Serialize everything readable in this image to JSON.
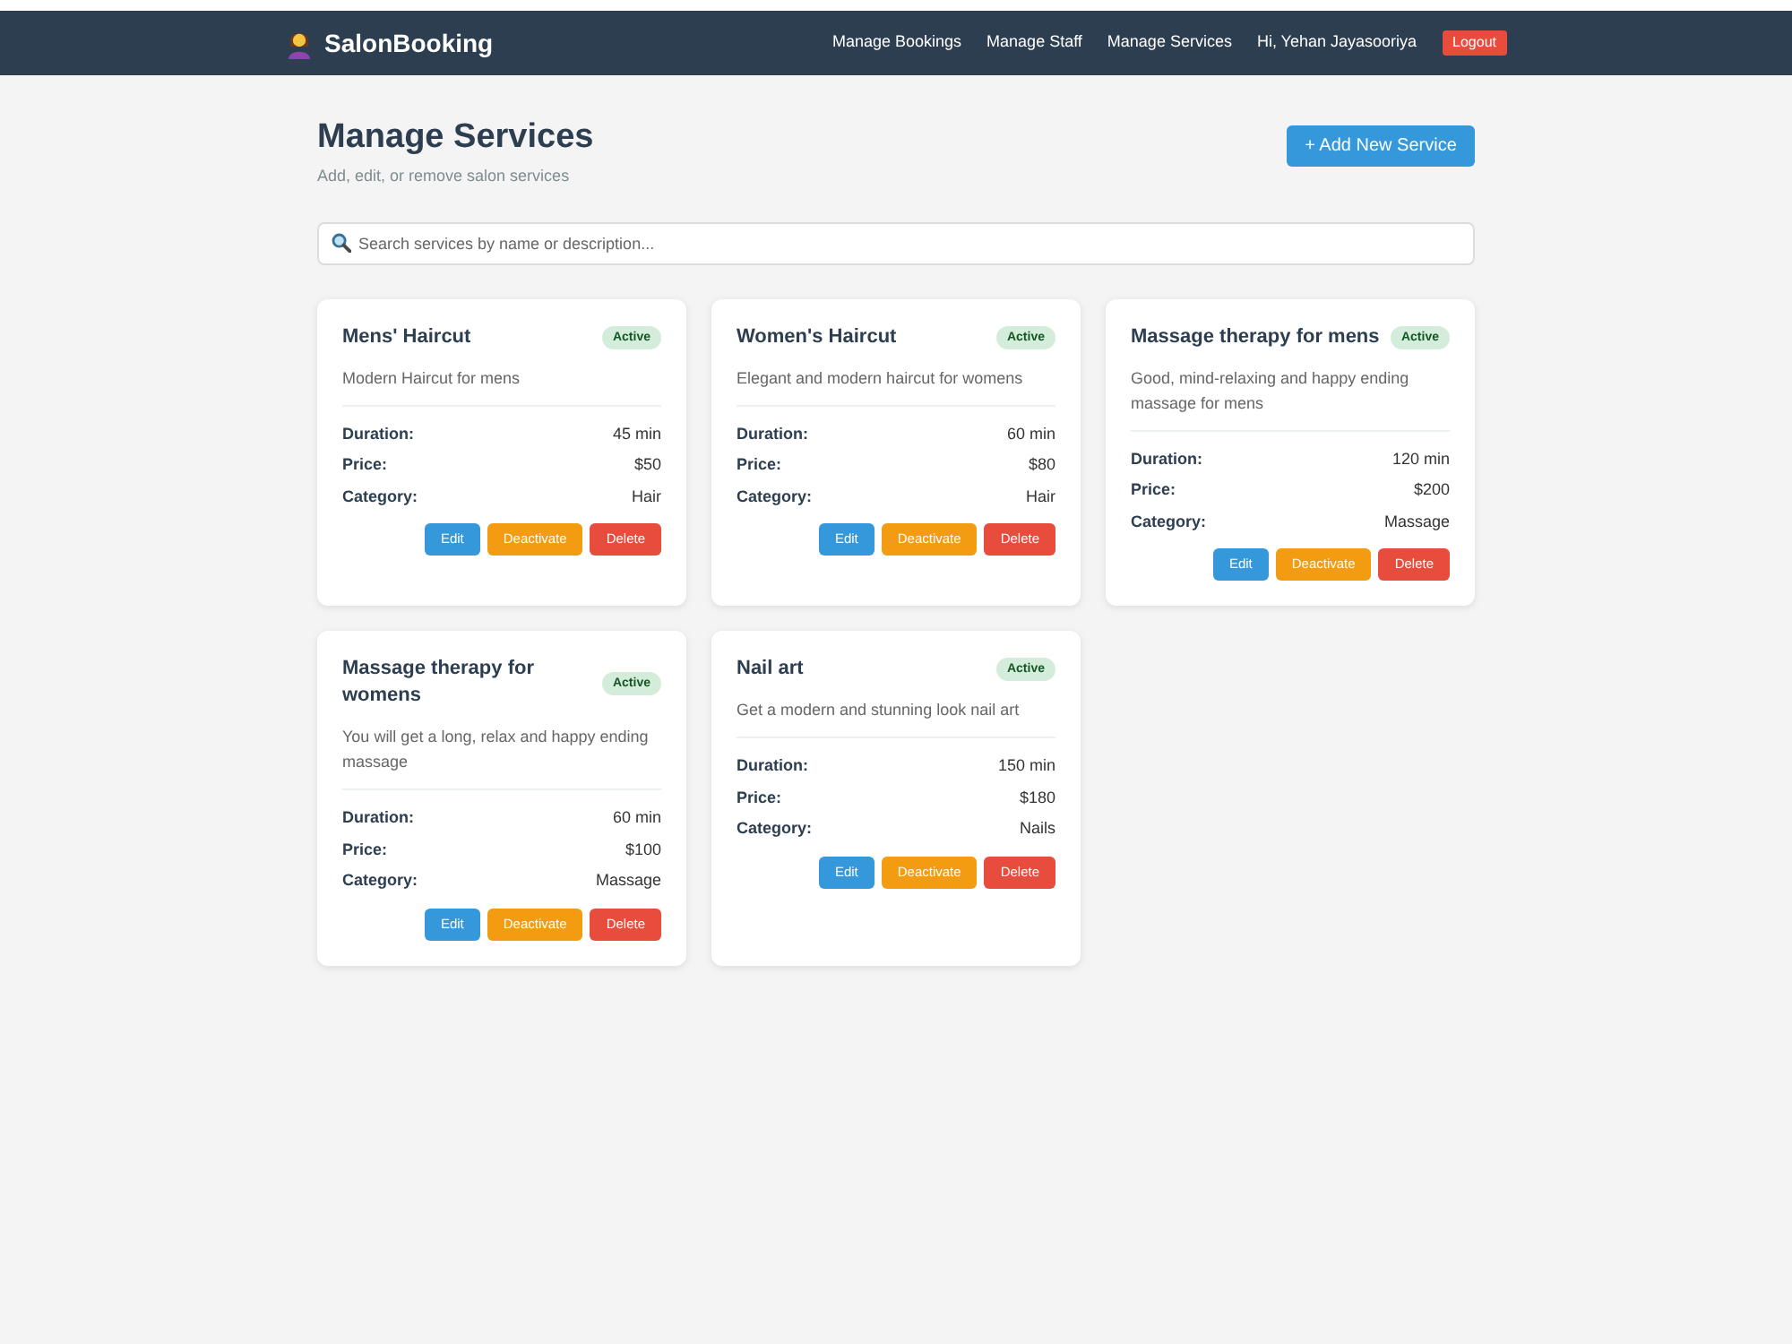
{
  "header": {
    "brand": "SalonBooking",
    "nav_links": [
      "Manage Bookings",
      "Manage Staff",
      "Manage Services"
    ],
    "greeting": "Hi, Yehan Jayasooriya",
    "logout": "Logout"
  },
  "page": {
    "title": "Manage Services",
    "subtitle": "Add, edit, or remove salon services",
    "add_button": "+ Add New Service"
  },
  "search": {
    "placeholder": "Search services by name or description..."
  },
  "services": [
    {
      "name": "Mens' Haircut",
      "status": "Active",
      "active": true,
      "description": "Modern Haircut for mens",
      "details": [
        {
          "label": "Duration:",
          "value": "45 min"
        },
        {
          "label": "Price:",
          "value": "$50"
        },
        {
          "label": "Category:",
          "value": "Hair"
        }
      ],
      "actions": [
        {
          "label": "Edit",
          "kind": "edit"
        },
        {
          "label": "Deactivate",
          "kind": "toggle"
        },
        {
          "label": "Delete",
          "kind": "delete"
        }
      ]
    },
    {
      "name": "Women's Haircut",
      "status": "Active",
      "active": true,
      "description": "Elegant and modern haircut for womens",
      "details": [
        {
          "label": "Duration:",
          "value": "60 min"
        },
        {
          "label": "Price:",
          "value": "$80"
        },
        {
          "label": "Category:",
          "value": "Hair"
        }
      ],
      "actions": [
        {
          "label": "Edit",
          "kind": "edit"
        },
        {
          "label": "Deactivate",
          "kind": "toggle"
        },
        {
          "label": "Delete",
          "kind": "delete"
        }
      ]
    },
    {
      "name": "Massage therapy for mens",
      "status": "Active",
      "active": true,
      "description": "Good, mind-relaxing and happy ending massage for mens",
      "details": [
        {
          "label": "Duration:",
          "value": "120 min"
        },
        {
          "label": "Price:",
          "value": "$200"
        },
        {
          "label": "Category:",
          "value": "Massage"
        }
      ],
      "actions": [
        {
          "label": "Edit",
          "kind": "edit"
        },
        {
          "label": "Deactivate",
          "kind": "toggle"
        },
        {
          "label": "Delete",
          "kind": "delete"
        }
      ]
    },
    {
      "name": "Massage therapy for womens",
      "status": "Active",
      "active": true,
      "description": "You will get a long, relax and happy ending massage",
      "details": [
        {
          "label": "Duration:",
          "value": "60 min"
        },
        {
          "label": "Price:",
          "value": "$100"
        },
        {
          "label": "Category:",
          "value": "Massage"
        }
      ],
      "actions": [
        {
          "label": "Edit",
          "kind": "edit"
        },
        {
          "label": "Deactivate",
          "kind": "toggle"
        },
        {
          "label": "Delete",
          "kind": "delete"
        }
      ]
    },
    {
      "name": "Nail art",
      "status": "Active",
      "active": true,
      "description": "Get a modern and stunning look nail art",
      "details": [
        {
          "label": "Duration:",
          "value": "150 min"
        },
        {
          "label": "Price:",
          "value": "$180"
        },
        {
          "label": "Category:",
          "value": "Nails"
        }
      ],
      "actions": [
        {
          "label": "Edit",
          "kind": "edit"
        },
        {
          "label": "Deactivate",
          "kind": "toggle"
        },
        {
          "label": "Delete",
          "kind": "delete"
        }
      ]
    }
  ]
}
